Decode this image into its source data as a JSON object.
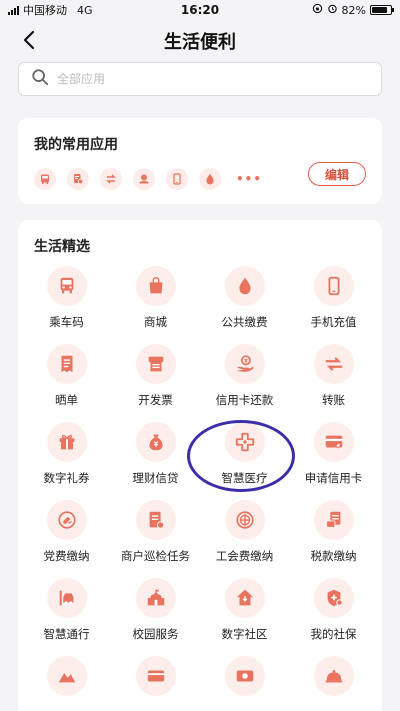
{
  "status_bar": {
    "carrier": "中国移动",
    "network": "4G",
    "time": "16:20",
    "battery": "82%"
  },
  "nav": {
    "back_icon": "chevron-left-icon",
    "title": "生活便利"
  },
  "search": {
    "placeholder": "全部应用",
    "value": ""
  },
  "favorites": {
    "title": "我的常用应用",
    "icons": [
      "bus-icon",
      "invoice-icon",
      "transfer-icon",
      "party-fee-icon",
      "phone-icon",
      "drop-icon"
    ],
    "more": "•••",
    "edit_label": "编辑"
  },
  "life": {
    "title": "生活精选",
    "items": [
      {
        "label": "乘车码",
        "icon": "bus-icon"
      },
      {
        "label": "商城",
        "icon": "shopping-bag-icon"
      },
      {
        "label": "公共缴费",
        "icon": "drop-icon"
      },
      {
        "label": "手机充值",
        "icon": "phone-icon"
      },
      {
        "label": "晒单",
        "icon": "receipt-icon"
      },
      {
        "label": "开发票",
        "icon": "invoice-printer-icon"
      },
      {
        "label": "信用卡还款",
        "icon": "hand-coin-icon"
      },
      {
        "label": "转账",
        "icon": "transfer-icon"
      },
      {
        "label": "数字礼券",
        "icon": "gift-icon"
      },
      {
        "label": "理财信贷",
        "icon": "money-bag-icon"
      },
      {
        "label": "智慧医疗",
        "icon": "medical-cross-icon"
      },
      {
        "label": "申请信用卡",
        "icon": "card-icon"
      },
      {
        "label": "党费缴纳",
        "icon": "party-icon"
      },
      {
        "label": "商户巡检任务",
        "icon": "document-icon"
      },
      {
        "label": "工会费缴纳",
        "icon": "union-icon"
      },
      {
        "label": "税款缴纳",
        "icon": "tax-icon"
      },
      {
        "label": "智慧通行",
        "icon": "car-icon"
      },
      {
        "label": "校园服务",
        "icon": "school-icon"
      },
      {
        "label": "数字社区",
        "icon": "home-icon"
      },
      {
        "label": "我的社保",
        "icon": "shield-plus-icon"
      },
      {
        "label": "",
        "icon": "mountain-icon"
      },
      {
        "label": "",
        "icon": "card-gear-icon"
      },
      {
        "label": "",
        "icon": "card-coin-icon"
      },
      {
        "label": "",
        "icon": "cloche-icon"
      }
    ]
  },
  "colors": {
    "accent": "#e8735f",
    "icon_bg": "#fdeeeb",
    "annotation": "#3a2fa8"
  }
}
